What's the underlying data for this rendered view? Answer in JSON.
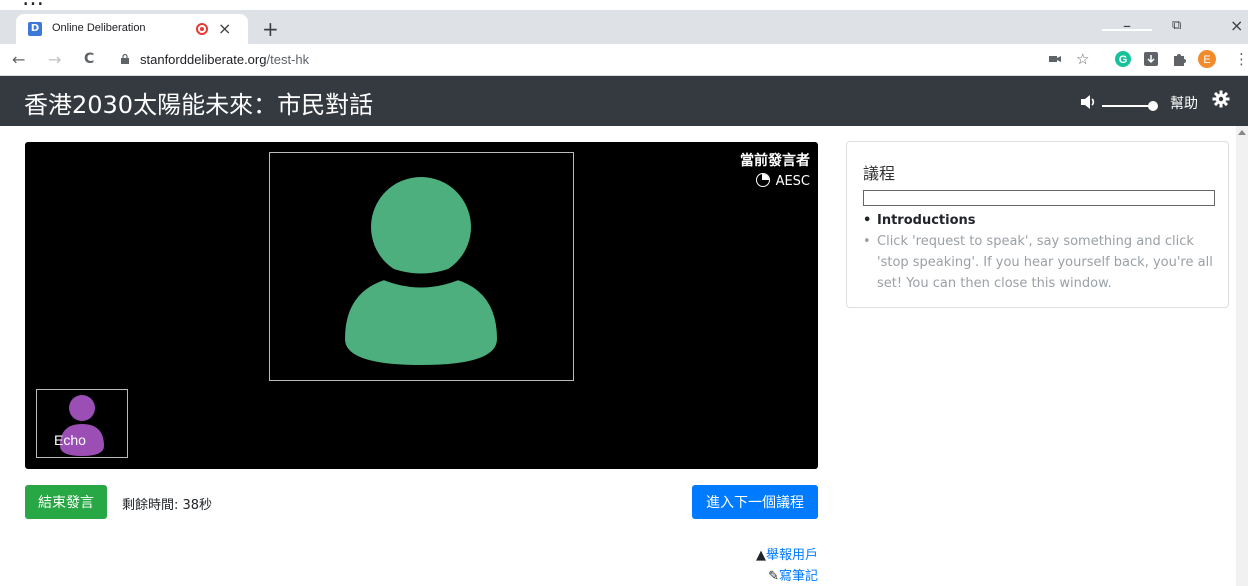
{
  "browser": {
    "tab_title": "Online Deliberation",
    "favicon_letter": "D",
    "url_host": "stanforddeliberate.org",
    "url_path": "/test-hk",
    "profile_initial": "E",
    "grammarly_letter": "G",
    "icons": {
      "back": "←",
      "forward": "→",
      "reload": "C",
      "close": "×",
      "newtab": "+",
      "minimize": "–",
      "restore": "⧉",
      "window_close": "×",
      "star": "☆",
      "menu": "⋮"
    }
  },
  "header": {
    "title": "香港2030太陽能未來：市民對話",
    "help_label": "幫助",
    "volume_icon": "speaker-icon",
    "settings_icon": "gear-icon"
  },
  "video": {
    "current_speaker_label": "當前發言者",
    "current_speaker_name": "AESC",
    "thumbnail_name": "Echo",
    "main_avatar_color": "#4caf7d",
    "thumb_avatar_color": "#9b4fb5"
  },
  "controls": {
    "end_speaking_label": "結束發言",
    "remaining_time": "剩餘時間: 38秒",
    "next_agenda_label": "進入下一個議程",
    "report_user_label": "舉報用戶",
    "write_notes_label": "寫筆記"
  },
  "agenda": {
    "title": "議程",
    "items": [
      {
        "label": "Introductions",
        "state": "active"
      },
      {
        "label": "Click 'request to speak', say something and click 'stop speaking'. If you hear yourself back, you're all set! You can then close this window.",
        "state": "pending"
      }
    ]
  },
  "colors": {
    "header_bg": "#343a40",
    "green_button": "#28a745",
    "blue_button": "#007bff"
  }
}
